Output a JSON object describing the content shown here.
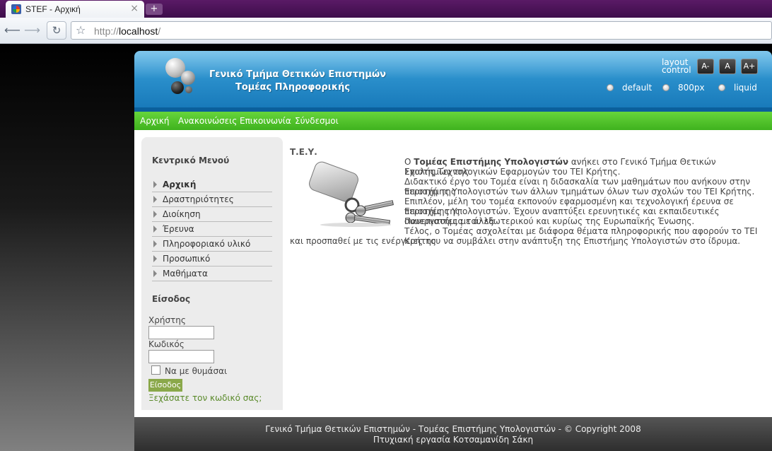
{
  "browser": {
    "tab_title": "STEF - Αρχική",
    "close_glyph": "×",
    "newtab_glyph": "+",
    "url_scheme": "http://",
    "url_host": "localhost",
    "url_path": "/",
    "back_glyph": "⟵",
    "forward_glyph": "⟶",
    "reload_glyph": "↻",
    "star_glyph": "☆"
  },
  "header": {
    "title": "Γενικό Τμήμα Θετικών Επιστημών",
    "subtitle": "Τομέας Πληροφορικής",
    "layout_label_1": "layout",
    "layout_label_2": "control",
    "font_buttons": [
      "A-",
      "A",
      "A+"
    ],
    "layout_options": [
      "default",
      "800px",
      "liquid"
    ]
  },
  "nav": [
    "Αρχική",
    "Ανακοινώσεις",
    "Επικοινωνία",
    "Σύνδεσμοι"
  ],
  "sidebar": {
    "menu_title": "Κεντρικό Μενού",
    "menu": [
      "Αρχική",
      "Δραστηριότητες",
      "Διοίκηση",
      "Έρευνα",
      "Πληροφοριακό υλικό",
      "Προσωπικό",
      "Μαθήματα"
    ],
    "login_title": "Είσοδος",
    "user_label": "Χρήστης",
    "pass_label": "Κωδικός",
    "remember_label": "Να με θυμάσαι",
    "login_button": "Είσοδος",
    "forgot": "Ξεχάσατε τον κωδικό σας;"
  },
  "main": {
    "heading": "Τ.Ε.Υ.",
    "p1_pre": "Ο ",
    "p1_bold": "Τομέας Επιστήμης Υπολογιστών",
    "p1_post": " ανήκει στο Γενικό Τμήμα Θετικών Επιστημών της",
    "p2": "Σχολής Τεχνολογικών Εφαρμογών του ΤΕΙ Κρήτης.",
    "p3": "Διδακτικό έργο του Τομέα είναι η διδασκαλία των μαθημάτων που ανήκουν στην περιοχή της",
    "p4": "Επιστήμης Υπολογιστών των άλλων τμημάτων όλων των σχολών του ΤΕΙ Κρήτης.",
    "p5": "Επιπλέον, μέλη του τομέα εκπονούν εφαρμοσμένη και τεχνολογική έρευνα σε περιοχές της",
    "p6": "Επιστήμης Υπολογιστών. Έχουν αναπτύξει ερευνητικές και εκπαιδευτικές συνεργασίες με άλλα",
    "p7": "Πανεπιστήμια του εξωτερικού και κυρίως της Ευρωπαϊκής Ένωσης.",
    "p8": "Τέλος, ο Τομέας ασχολείται με διάφορα θέματα πληροφορικής που αφορούν το ΤΕΙ Κρήτης",
    "p9": "και προσπαθεί με τις ενέργειες του να συμβάλει στην ανάπτυξη της Επιστήμης Υπολογιστών στο ίδρυμα."
  },
  "footer": {
    "line1": "Γενικό Τμήμα Θετικών Επιστημών - Τομέας Επιστήμης Υπολογιστών - © Copyright 2008",
    "line2": "Πτυχιακή εργασία Κοτσαμανίδη Σάκη"
  }
}
